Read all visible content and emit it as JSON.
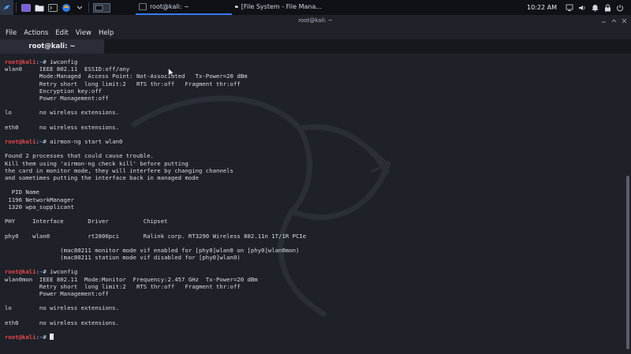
{
  "panel": {
    "clock": "10:22 AM",
    "tasks": [
      {
        "label": "root@kali: ~"
      },
      {
        "label": "[File System - File Mana..."
      }
    ],
    "colors": {
      "accent": "#367bf0",
      "panel_bg": "#0f1116"
    }
  },
  "window": {
    "title": "root@kali: ~",
    "menu": [
      "File",
      "Actions",
      "Edit",
      "View",
      "Help"
    ],
    "tab_label": "root@kali: ~"
  },
  "terminal": {
    "prompt_user": "root@kali",
    "prompt_path": "~",
    "lines": [
      {
        "prompt": true,
        "cmd": "iwconfig"
      },
      {
        "text": "wlan0     IEEE 802.11  ESSID:off/any"
      },
      {
        "text": "          Mode:Managed  Access Point: Not-Associated   Tx-Power=20 dBm"
      },
      {
        "text": "          Retry short  long limit:2   RTS thr:off   Fragment thr:off"
      },
      {
        "text": "          Encryption key:off"
      },
      {
        "text": "          Power Management:off"
      },
      {
        "text": ""
      },
      {
        "text": "lo        no wireless extensions."
      },
      {
        "text": ""
      },
      {
        "text": "eth0      no wireless extensions."
      },
      {
        "text": ""
      },
      {
        "prompt": true,
        "cmd": "airmon-ng start wlan0"
      },
      {
        "text": ""
      },
      {
        "text": "Found 2 processes that could cause trouble."
      },
      {
        "text": "Kill them using 'airmon-ng check kill' before putting"
      },
      {
        "text": "the card in monitor mode, they will interfere by changing channels"
      },
      {
        "text": "and sometimes putting the interface back in managed mode"
      },
      {
        "text": ""
      },
      {
        "text": "  PID Name"
      },
      {
        "text": " 1196 NetworkManager"
      },
      {
        "text": " 1320 wpa_supplicant"
      },
      {
        "text": ""
      },
      {
        "text": "PHY     Interface       Driver          Chipset"
      },
      {
        "text": ""
      },
      {
        "text": "phy0    wlan0           rt2800pci       Ralink corp. RT3290 Wireless 802.11n 1T/1R PCIe"
      },
      {
        "text": ""
      },
      {
        "text": "                (mac80211 monitor mode vif enabled for [phy0]wlan0 on [phy0]wlan0mon)"
      },
      {
        "text": "                (mac80211 station mode vif disabled for [phy0]wlan0)"
      },
      {
        "text": ""
      },
      {
        "prompt": true,
        "cmd": "iwconfig"
      },
      {
        "text": "wlan0mon  IEEE 802.11  Mode:Monitor  Frequency:2.457 GHz  Tx-Power=20 dBm"
      },
      {
        "text": "          Retry short  long limit:2   RTS thr:off   Fragment thr:off"
      },
      {
        "text": "          Power Management:off"
      },
      {
        "text": ""
      },
      {
        "text": "lo        no wireless extensions."
      },
      {
        "text": ""
      },
      {
        "text": "eth0      no wireless extensions."
      },
      {
        "text": ""
      },
      {
        "prompt": true,
        "cmd": "",
        "cursor": true
      }
    ]
  }
}
